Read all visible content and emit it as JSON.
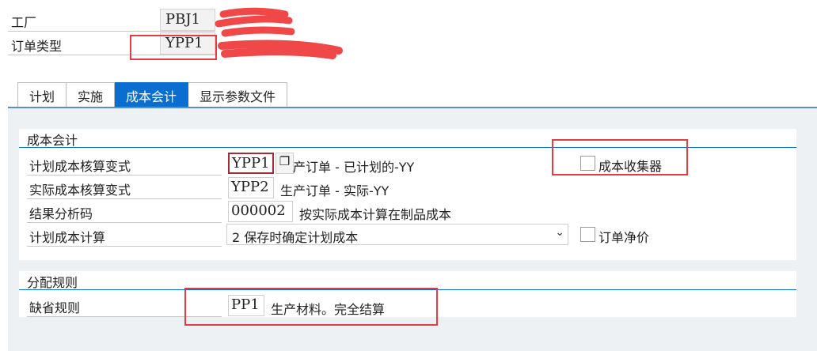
{
  "header": {
    "plant": {
      "label": "工厂",
      "value": "PBJ1"
    },
    "order_type": {
      "label": "订单类型",
      "value": "YPP1"
    }
  },
  "tabs": [
    {
      "label": "计划"
    },
    {
      "label": "实施"
    },
    {
      "label": "成本会计"
    },
    {
      "label": "显示参数文件"
    }
  ],
  "cost_accounting": {
    "title": "成本会计",
    "planned_valuation": {
      "label": "计划成本核算变式",
      "value": "YPP1",
      "desc": "产订单 - 已计划的-YY"
    },
    "actual_valuation": {
      "label": "实际成本核算变式",
      "value": "YPP2",
      "desc": "生产订单 - 实际-YY"
    },
    "results_analysis": {
      "label": "结果分析码",
      "value": "000002",
      "desc": "按实际成本计算在制品成本"
    },
    "planned_costing": {
      "label": "计划成本计算",
      "value": "2 保存时确定计划成本"
    },
    "cost_collector": {
      "label": "成本收集器",
      "checked": false
    },
    "order_net_price": {
      "label": "订单净价",
      "checked": false
    }
  },
  "settlement": {
    "title": "分配规则",
    "default_rule": {
      "label": "缺省规则",
      "value": "PP1",
      "desc": "生产材料。完全结算"
    }
  },
  "icons": {
    "f4": "value-help-icon",
    "dropdown": "chevron-down-icon"
  }
}
